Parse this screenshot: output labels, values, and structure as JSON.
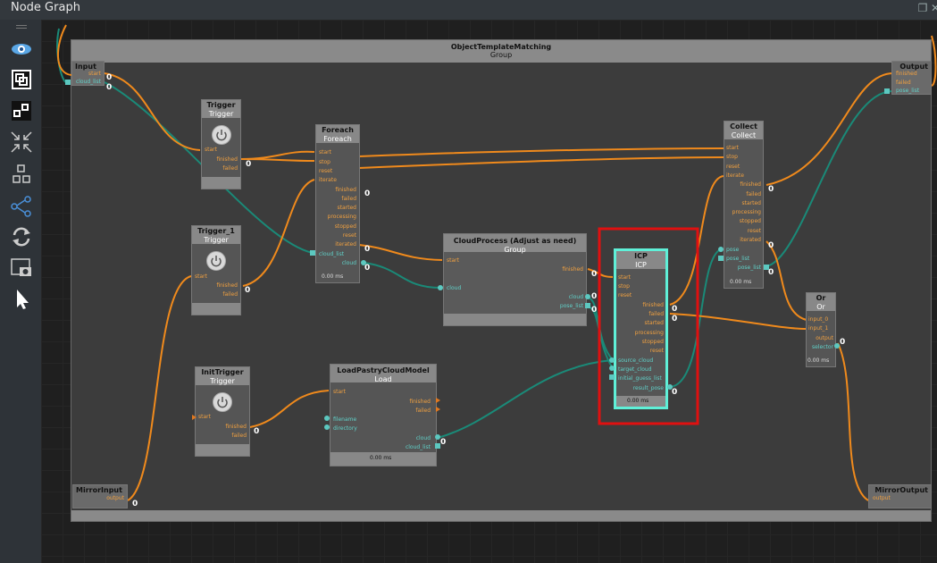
{
  "window": {
    "title": "Node Graph"
  },
  "toolbar": {
    "items": [
      "eye-icon",
      "frame-icon",
      "nodes-icon",
      "collapse-icon",
      "layout-icon",
      "connect-icon",
      "refresh-icon",
      "screenshot-icon",
      "pointer-icon"
    ]
  },
  "group": {
    "title": "ObjectTemplateMatching",
    "type": "Group"
  },
  "nodes": {
    "input": {
      "title": "Input",
      "ports": [
        "start",
        "cloud_list"
      ]
    },
    "output": {
      "title": "Output",
      "ports": [
        "finished",
        "failed",
        "pose_list"
      ]
    },
    "trigger": {
      "title": "Trigger",
      "type": "Trigger",
      "in": [
        "start"
      ],
      "out": [
        "finished",
        "failed"
      ]
    },
    "trigger1": {
      "title": "Trigger_1",
      "type": "Trigger",
      "in": [
        "start"
      ],
      "out": [
        "finished",
        "failed"
      ]
    },
    "inittrigger": {
      "title": "InitTrigger",
      "type": "Trigger",
      "in": [
        "start"
      ],
      "out": [
        "finished",
        "failed"
      ]
    },
    "foreach": {
      "title": "Foreach",
      "type": "Foreach",
      "in": [
        "start",
        "stop",
        "reset",
        "iterate",
        "cloud_list"
      ],
      "out": [
        "finished",
        "failed",
        "started",
        "processing",
        "stopped",
        "reset",
        "iterated",
        "cloud"
      ],
      "ms": "0.00 ms"
    },
    "cloudprocess": {
      "title": "CloudProcess  (Adjust as need)",
      "type": "Group",
      "in": [
        "start",
        "cloud"
      ],
      "out": [
        "finished",
        "cloud",
        "pose_list"
      ]
    },
    "loadpastry": {
      "title": "LoadPastryCloudModel",
      "type": "Load",
      "in": [
        "start",
        "filename",
        "directory"
      ],
      "out": [
        "finished",
        "failed",
        "cloud",
        "cloud_list"
      ],
      "ms": "0.00 ms"
    },
    "icp": {
      "title": "ICP",
      "type": "ICP",
      "in": [
        "start",
        "stop",
        "reset",
        "source_cloud",
        "target_cloud",
        "initial_guess_list"
      ],
      "out": [
        "finished",
        "failed",
        "started",
        "processing",
        "stopped",
        "reset",
        "result_pose"
      ],
      "ms": "0.00 ms"
    },
    "collect": {
      "title": "Collect",
      "type": "Collect",
      "in": [
        "start",
        "stop",
        "reset",
        "iterate",
        "pose",
        "pose_list"
      ],
      "out": [
        "finished",
        "failed",
        "started",
        "processing",
        "stopped",
        "reset",
        "iterated",
        "pose_list"
      ],
      "ms": "0.00 ms"
    },
    "or": {
      "title": "Or",
      "type": "Or",
      "in": [
        "input_0",
        "input_1"
      ],
      "out": [
        "output",
        "selector"
      ],
      "ms": "0.00 ms"
    },
    "mirrorinput": {
      "title": "MirrorInput",
      "ports": [
        "output"
      ]
    },
    "mirroroutput": {
      "title": "MirrorOutput",
      "ports": [
        "output"
      ]
    }
  },
  "counter": "0",
  "highlight_color": "#e01010",
  "orange_wire": "#f08a1c",
  "teal_wire": "#1a8a78"
}
